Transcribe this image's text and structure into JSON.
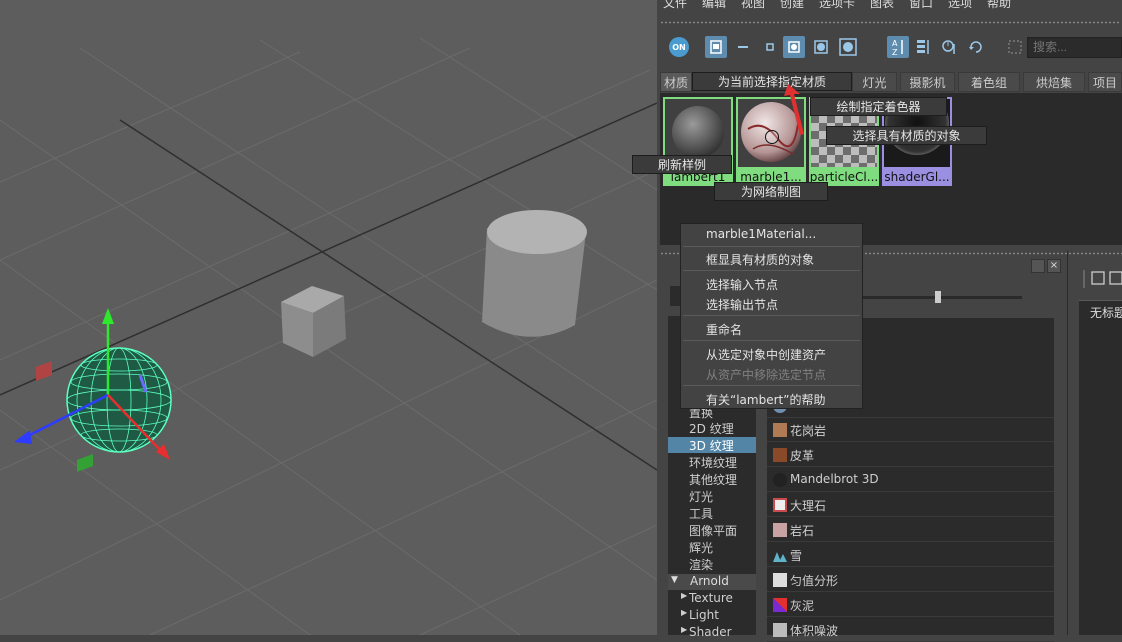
{
  "menubar": [
    "文件",
    "编辑",
    "视图",
    "创建",
    "选项卡",
    "图表",
    "窗口",
    "选项",
    "帮助"
  ],
  "toolbar": {
    "on_label": "ON",
    "search_placeholder": "搜索..."
  },
  "tabs": [
    "材质",
    "灯光",
    "摄影机",
    "着色组",
    "烘焙集",
    "项目"
  ],
  "swatches": [
    {
      "label": "lambert1"
    },
    {
      "label": "marble1..."
    },
    {
      "label": "particleCl..."
    },
    {
      "label": "shaderGl..."
    }
  ],
  "tooltips": {
    "assign_material": "为当前选择指定材质",
    "paint_shader": "绘制指定着色器",
    "select_objects": "选择具有材质的对象",
    "refresh_swatch": "刷新样例",
    "graph_network": "为网络制图"
  },
  "context_menu": {
    "items": [
      {
        "label": "marble1Material...",
        "enabled": true
      },
      {
        "label": "框显具有材质的对象",
        "enabled": true
      },
      {
        "label": "选择输入节点",
        "enabled": true
      },
      {
        "label": "选择输出节点",
        "enabled": true
      },
      {
        "label": "重命名",
        "enabled": true
      },
      {
        "label": "从选定对象中创建资产",
        "enabled": true
      },
      {
        "label": "从资产中移除选定节点",
        "enabled": false
      },
      {
        "label": "有关“lambert”的帮助",
        "enabled": true
      }
    ]
  },
  "tree": {
    "items": [
      "置换",
      "2D 纹理",
      "3D 纹理",
      "环境纹理",
      "其他纹理",
      "灯光",
      "工具",
      "图像平面",
      "辉光",
      "渲染"
    ],
    "selected": "3D 纹理",
    "arnold_header": "Arnold",
    "arnold_items": [
      "Texture",
      "Light",
      "Shader"
    ]
  },
  "node_list": [
    {
      "label": "",
      "icon": "blue-sphere-icon",
      "color": "#6f8fb0"
    },
    {
      "label": "花岗岩",
      "icon": "granite-icon",
      "color": "#b07a55"
    },
    {
      "label": "皮革",
      "icon": "leather-icon",
      "color": "#8a4a2a"
    },
    {
      "label": "Mandelbrot 3D",
      "icon": "mandelbrot-icon",
      "color": "#222222"
    },
    {
      "label": "大理石",
      "icon": "marble-icon",
      "color": "#c94b4b"
    },
    {
      "label": "岩石",
      "icon": "rock-icon",
      "color": "#c9a3a3"
    },
    {
      "label": "雪",
      "icon": "snow-icon",
      "color": "#5fb4c9"
    },
    {
      "label": "匀值分形",
      "icon": "solid-fractal-icon",
      "color": "#dddddd"
    },
    {
      "label": "灰泥",
      "icon": "stucco-icon",
      "color": "#7a2ad0"
    },
    {
      "label": "体积噪波",
      "icon": "volume-noise-icon",
      "color": "#bbbbbb"
    }
  ],
  "side_panel": {
    "title": "无标题"
  }
}
